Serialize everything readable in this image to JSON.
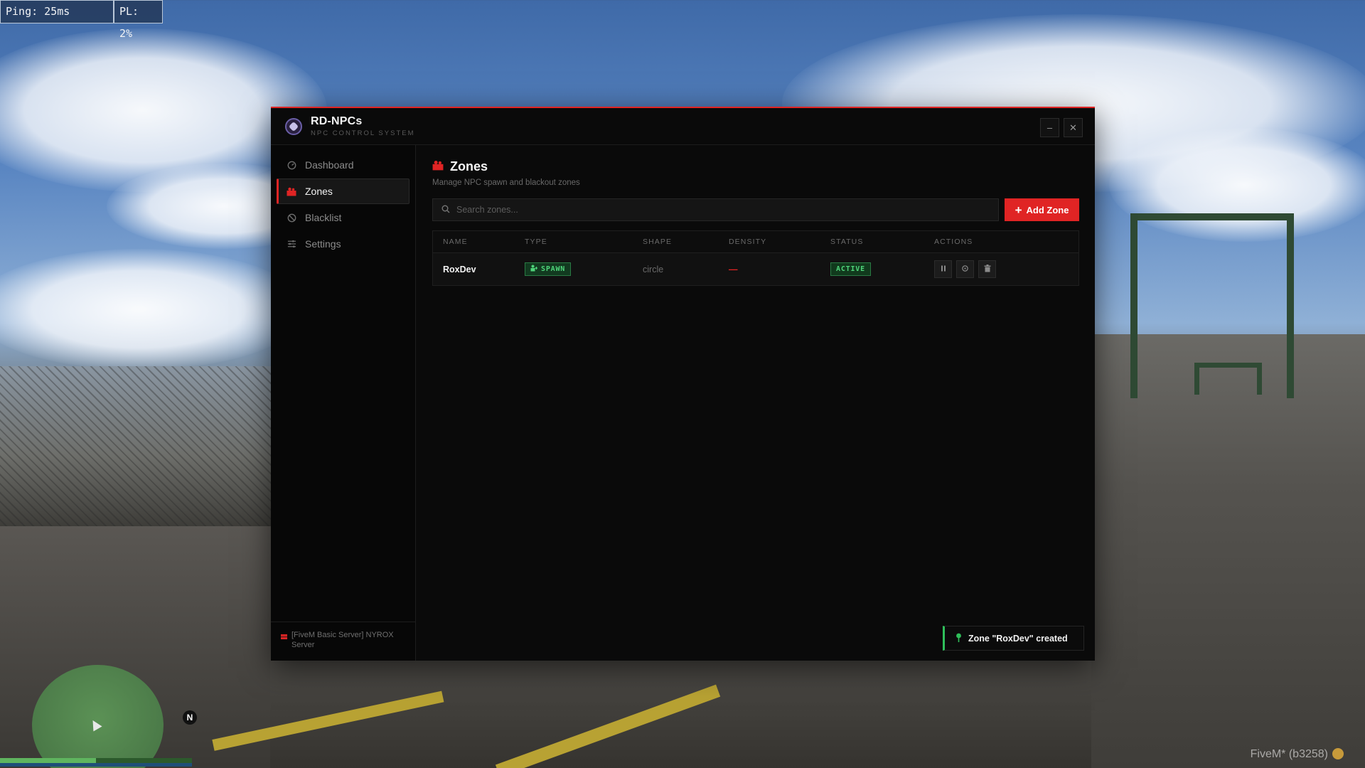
{
  "hud": {
    "ping": "Ping: 25ms",
    "packet_loss": "PL: 2%",
    "compass_north": "N",
    "build_watermark": "FiveM* (b3258)"
  },
  "window": {
    "app_name": "RD-NPCs",
    "app_subtitle": "NPC CONTROL SYSTEM",
    "minimize_label": "–",
    "close_label": "✕",
    "accent_color": "#e02424"
  },
  "sidebar": {
    "items": [
      {
        "label": "Dashboard",
        "icon": "dashboard-gauge-icon",
        "active": false
      },
      {
        "label": "Zones",
        "icon": "map-pin-zones-icon",
        "active": true
      },
      {
        "label": "Blacklist",
        "icon": "ban-icon",
        "active": false
      },
      {
        "label": "Settings",
        "icon": "sliders-icon",
        "active": false
      }
    ],
    "server_name": "[FiveM Basic Server] NYROX Server"
  },
  "main": {
    "title": "Zones",
    "subtitle": "Manage NPC spawn and blackout zones",
    "search_placeholder": "Search zones...",
    "add_button_label": "Add Zone",
    "table": {
      "columns": [
        "NAME",
        "TYPE",
        "SHAPE",
        "DENSITY",
        "STATUS",
        "ACTIONS"
      ],
      "rows": [
        {
          "name": "RoxDev",
          "type": "SPAWN",
          "shape": "circle",
          "density": "—",
          "status": "ACTIVE",
          "actions": [
            "pause-icon",
            "teleport-target-icon",
            "delete-trash-icon"
          ]
        }
      ]
    }
  },
  "toast": {
    "message": "Zone \"RoxDev\" created",
    "color": "#2fbf5a"
  }
}
